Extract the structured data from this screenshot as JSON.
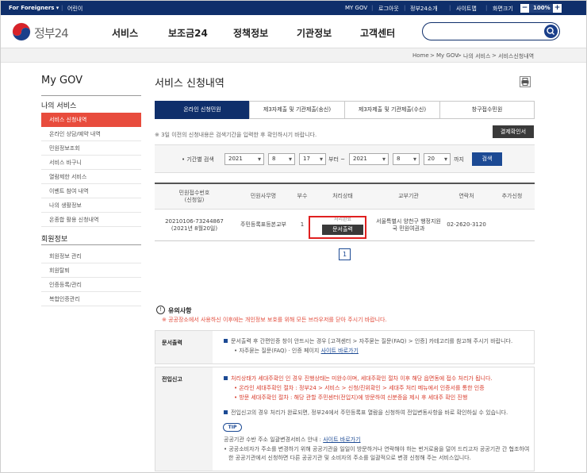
{
  "topbar": {
    "for_foreigners": "For Foreigners",
    "kids": "어린이",
    "my_gov": "MY GOV",
    "logout": "로그아웃",
    "about": "정부24소개",
    "sitemap": "사이트맵",
    "zoom_label": "화면크기",
    "zoom_value": "100%",
    "zoom_minus": "−",
    "zoom_plus": "+"
  },
  "header": {
    "logo_text": "정부24",
    "nav": [
      "서비스",
      "보조금24",
      "정책정보",
      "기관정보",
      "고객센터"
    ],
    "search_placeholder": ""
  },
  "breadcrumb": {
    "home": "Home",
    "sep": ">",
    "items": [
      "My GOV",
      "나의 서비스",
      "서비스신청내역"
    ]
  },
  "sidebar": {
    "title": "My GOV",
    "section1": "나의 서비스",
    "items1": [
      "서비스 신청내역",
      "온라인 상담/예약 내역",
      "민원정보조회",
      "서비스 바구니",
      "열람제한 서비스",
      "이벤트 참여 내역",
      "나의 생활정보",
      "온종합 활용 신청내역"
    ],
    "section2": "회원정보",
    "items2": [
      "회원정보 관리",
      "회원탈퇴",
      "인증등록/관리",
      "복합인증관리"
    ]
  },
  "main": {
    "title": "서비스 신청내역",
    "tabs": [
      "온라인 신청민원",
      "제3자제출 및 기관제출(송신)",
      "제3자제출 및 기관제출(수신)",
      "창구접수민원"
    ],
    "note": "※ 3일 이전의 신청내용은 검색기간을 입력한 후 확인하시기 바랍니다.",
    "confirm_btn": "결제확인서",
    "filter": {
      "label": "• 기간별 검색",
      "from_year": "2021",
      "from_month": "8",
      "from_day": "17",
      "from_suffix": "부터 ~",
      "to_year": "2021",
      "to_month": "8",
      "to_day": "20",
      "to_suffix": "까지",
      "search_btn": "검색"
    },
    "table": {
      "headers": [
        "민원접수번호\n(신청일)",
        "민원사무명",
        "부수",
        "처리상태",
        "교부기관",
        "연락처",
        "추가신청"
      ],
      "row": {
        "receipt": "20210106-73244867",
        "date": "(2021년 8월20일)",
        "name": "주민등록표등본교부",
        "count": "1",
        "status": "처리완료",
        "print_btn": "문서출력",
        "agency1": "서울특별시 양천구 행정지원",
        "agency2": "국 민원여권과",
        "phone": "02-2620-3120",
        "extra": ""
      }
    },
    "page": "1"
  },
  "caution": {
    "title": "유의사항",
    "text": "※ 공공장소에서 사용하신 이후에는 개인정보 보호를 위해 모든 브라우저를 닫아 주시기 바랍니다.",
    "print_head": "문서출력",
    "print_line1": "문서출력 후 간편인증 창이 안뜨시는 경우 [고객센터 > 자주묻는 질문(FAQ) > 인증] 카테고리를 참고해 주시기 바랍니다.",
    "print_line2": "• 자주묻는 질문(FAQ) · 인증 페이지",
    "print_link": "사이트 바로가기",
    "move_head": "전입신고",
    "move_line1": "처리상태가 세대주확인 인 경우 진행상태는 미완수이며, 세대주확인 절차 이후 해당 읍면동에 접수 처리가 됩니다.",
    "move_line2": "• 온라인 세대주확인 절차 : 정부24 > 서비스 > 신청/진위확인 > 세대주 처리 메뉴에서 인증서를 통한 인증",
    "move_line3": "• 방문 세대주확인 절차 : 해당 관할 주민센터(전입지)에 방문하여 신분증을 제시 후 세대주 확인 진행",
    "move_line4": "전입신고의 경우 처리가 완료되면, 정부24에서 주민등록표 열람을 신청하여 전입변동사항을 바로 확인하실 수 있습니다.",
    "tip": "TIP",
    "tip_line1": "공공기관 수반 주소 일괄변경서비스 안내 :",
    "tip_link": "사이트 바로가기",
    "tip_line2": "• 공공소비자가 주소를 변경하기 위해 공공기관을 일일이 방문하거나 연락해야 하는 번거로움을 덜어 드리고자 공공기관 간 협조하여",
    "tip_line3": "한 공공기관에서 신청하면 다른 공공기관 및 소비자의 주소를 일괄적으로 변경 신청해 주는 서비스입니다."
  }
}
